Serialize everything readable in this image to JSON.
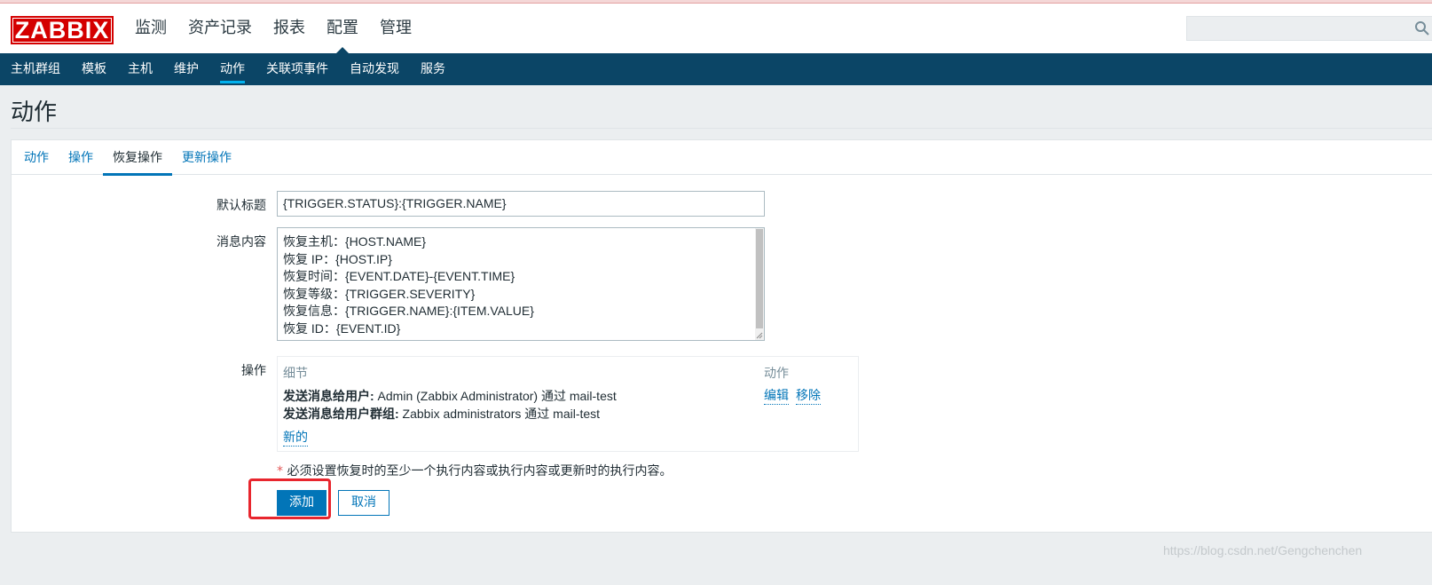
{
  "header": {
    "logo_text": "ZABBIX",
    "main_menu": [
      "监测",
      "资产记录",
      "报表",
      "配置",
      "管理"
    ],
    "active_main": "配置",
    "search_placeholder": ""
  },
  "subnav": {
    "items": [
      "主机群组",
      "模板",
      "主机",
      "维护",
      "动作",
      "关联项事件",
      "自动发现",
      "服务"
    ],
    "active": "动作"
  },
  "page": {
    "title": "动作"
  },
  "tabs": {
    "items": [
      "动作",
      "操作",
      "恢复操作",
      "更新操作"
    ],
    "active": "恢复操作"
  },
  "form": {
    "subject_label": "默认标题",
    "subject_value": "{TRIGGER.STATUS}:{TRIGGER.NAME}",
    "message_label": "消息内容",
    "message_lines": [
      "恢复主机：{HOST.NAME}",
      "恢复 IP：{HOST.IP}",
      "恢复时间：{EVENT.DATE}-{EVENT.TIME}",
      "恢复等级：{TRIGGER.SEVERITY}",
      "恢复信息：{TRIGGER.NAME}:{ITEM.VALUE}",
      "恢复 ID：{EVENT.ID}"
    ],
    "operations_label": "操作",
    "operations": {
      "col_details": "细节",
      "col_action": "动作",
      "rows": [
        {
          "bold": "发送消息给用户:",
          "text": " Admin (Zabbix Administrator) 通过 mail-test"
        },
        {
          "bold": "发送消息给用户群组:",
          "text": " Zabbix administrators 通过 mail-test"
        }
      ],
      "edit_label": "编辑",
      "remove_label": "移除",
      "new_label": "新的"
    },
    "note_star": "*",
    "note_text": " 必须设置恢复时的至少一个执行内容或执行内容或更新时的执行内容。",
    "add_button": "添加",
    "cancel_button": "取消"
  },
  "watermark": "https://blog.csdn.net/Gengchenchen",
  "colors": {
    "brand_red": "#d40000",
    "nav_blue": "#0b4566",
    "link_blue": "#0275b8",
    "highlight_red": "#e8262e"
  }
}
